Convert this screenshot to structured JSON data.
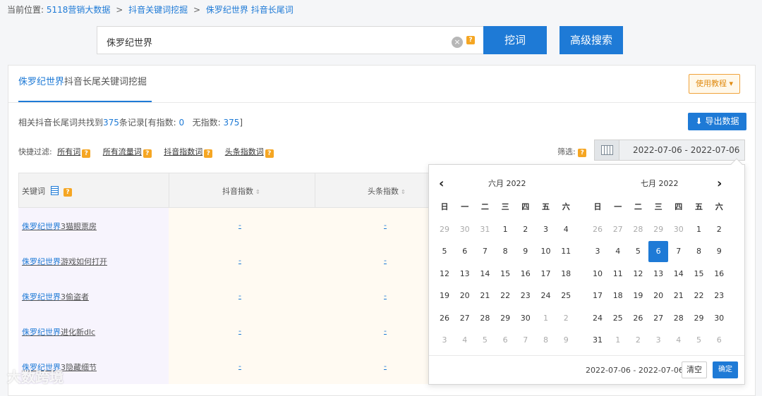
{
  "breadcrumb": {
    "prefix": "当前位置:",
    "items": [
      "5118营销大数据",
      "抖音关键词挖掘",
      "侏罗纪世界 抖音长尾词"
    ],
    "sep": ">"
  },
  "search": {
    "value": "侏罗纪世界",
    "clear_icon": "×",
    "help": "?",
    "dig_label": "挖词",
    "advanced_label": "高级搜索"
  },
  "tab": {
    "highlight": "侏罗纪世界",
    "rest": "抖音长尾关键词挖掘"
  },
  "tutorial_label": "使用教程 ▾",
  "export_label": "导出数据",
  "summary": {
    "prefix": "相关抖音长尾词共找到",
    "total": "375",
    "mid1": "条记录[有指数:",
    "with_index": "0",
    "mid2": "无指数:",
    "without_index": "375",
    "suffix": "]"
  },
  "quick_filter": {
    "label": "快捷过滤:",
    "items": [
      "所有词",
      "所有流量词",
      "抖音指数词",
      "头条指数词"
    ]
  },
  "screen": {
    "label": "筛选:",
    "date_range": "2022-07-06 - 2022-07-06"
  },
  "table": {
    "headers": [
      "关键词",
      "抖音指数",
      "头条指数"
    ],
    "rows": [
      {
        "hl": "侏罗纪世界",
        "rest": "3猫眼票房",
        "douyin": "-",
        "toutiao": "-"
      },
      {
        "hl": "侏罗纪世界",
        "rest": "游戏如何打开",
        "douyin": "-",
        "toutiao": "-"
      },
      {
        "hl": "侏罗纪世界",
        "rest": "3偷盗者",
        "douyin": "-",
        "toutiao": "-"
      },
      {
        "hl": "侏罗纪世界",
        "rest": "进化新dlc",
        "douyin": "-",
        "toutiao": "-"
      },
      {
        "hl": "侏罗纪世界",
        "rest": "3隐藏细节",
        "douyin": "-",
        "toutiao": "-"
      }
    ]
  },
  "calendar": {
    "prev": "‹",
    "next": "›",
    "left_title": "六月 2022",
    "right_title": "七月 2022",
    "weekdays": [
      "日",
      "一",
      "二",
      "三",
      "四",
      "五",
      "六"
    ],
    "left_days": [
      [
        "29",
        "30",
        "31",
        "1",
        "2",
        "3",
        "4"
      ],
      [
        "5",
        "6",
        "7",
        "8",
        "9",
        "10",
        "11"
      ],
      [
        "12",
        "13",
        "14",
        "15",
        "16",
        "17",
        "18"
      ],
      [
        "19",
        "20",
        "21",
        "22",
        "23",
        "24",
        "25"
      ],
      [
        "26",
        "27",
        "28",
        "29",
        "30",
        "1",
        "2"
      ],
      [
        "3",
        "4",
        "5",
        "6",
        "7",
        "8",
        "9"
      ]
    ],
    "right_days": [
      [
        "26",
        "27",
        "28",
        "29",
        "30",
        "1",
        "2"
      ],
      [
        "3",
        "4",
        "5",
        "6",
        "7",
        "8",
        "9"
      ],
      [
        "10",
        "11",
        "12",
        "13",
        "14",
        "15",
        "16"
      ],
      [
        "17",
        "18",
        "19",
        "20",
        "21",
        "22",
        "23"
      ],
      [
        "24",
        "25",
        "26",
        "27",
        "28",
        "29",
        "30"
      ],
      [
        "31",
        "1",
        "2",
        "3",
        "4",
        "5",
        "6"
      ]
    ],
    "selected_day": "6",
    "footer_range": "2022-07-06 - 2022-07-06",
    "clear_label": "清空",
    "ok_label": "确定"
  },
  "watermark": "大数跨境"
}
